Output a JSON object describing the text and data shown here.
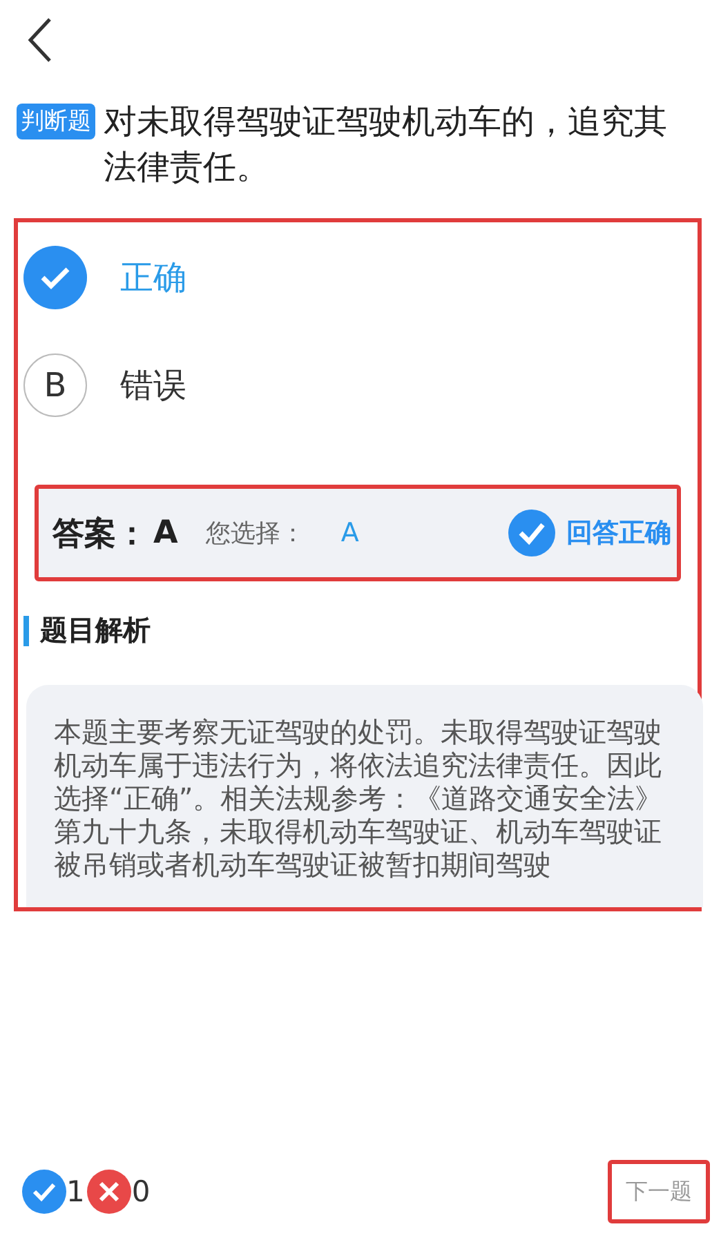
{
  "question": {
    "tag": "判断题",
    "text": "对未取得驾驶证驾驶机动车的，追究其法律责任。"
  },
  "options": [
    {
      "label": "正确",
      "selected": true
    },
    {
      "letter": "B",
      "label": "错误",
      "selected": false
    }
  ],
  "answer": {
    "label": "答案：",
    "value": "A",
    "choice_label": "您选择：",
    "choice": "A",
    "result": "回答正确",
    "correct": true
  },
  "analysis": {
    "heading": "题目解析",
    "text": "本题主要考察无证驾驶的处罚。未取得驾驶证驾驶机动车属于违法行为，将依法追究法律责任。因此选择“正确”。相关法规参考：《道路交通安全法》第九十九条，未取得机动车驾驶证、机动车驾驶证被吊销或者机动车驾驶证被暂扣期间驾驶"
  },
  "footer": {
    "right_count": "1",
    "wrong_count": "0",
    "next": "下一题"
  }
}
